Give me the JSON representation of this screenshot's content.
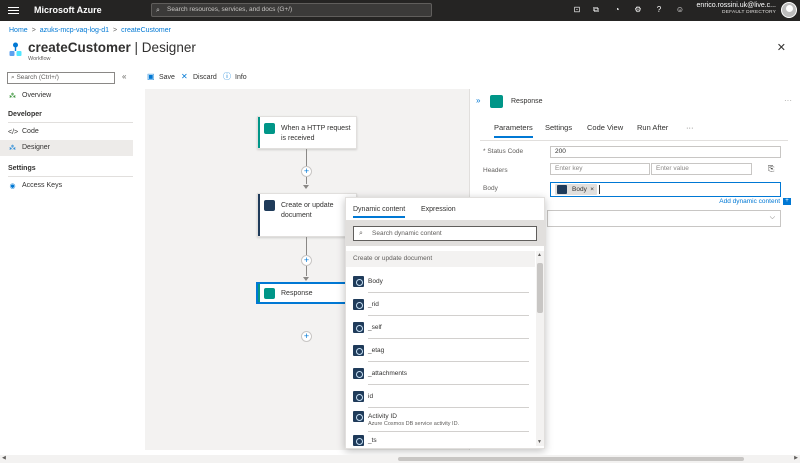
{
  "topbar": {
    "brand": "Microsoft Azure",
    "search_placeholder": "Search resources, services, and docs (G+/)",
    "user_name": "enrico.rossini.uk@live.c...",
    "user_directory": "DEFAULT DIRECTORY"
  },
  "breadcrumb": [
    "Home",
    "azuks-mcp-vaq-log-d1",
    "createCustomer"
  ],
  "header": {
    "title": "createCustomer",
    "title_suffix": " | Designer",
    "subtitle": "Workflow",
    "more": "···",
    "close": "✕"
  },
  "leftnav": {
    "search_placeholder": "Search (Ctrl+/)",
    "collapse": "«",
    "overview": "Overview",
    "developer_heading": "Developer",
    "code": "Code",
    "designer": "Designer",
    "settings_heading": "Settings",
    "access_keys": "Access Keys"
  },
  "toolbar": {
    "save": "Save",
    "discard": "Discard",
    "info": "Info"
  },
  "workflow": {
    "trigger": "When a HTTP request is received",
    "action1": "Create or update document",
    "action2": "Response",
    "add": "+"
  },
  "panel": {
    "title": "Response",
    "more": "···",
    "tabs": [
      "Parameters",
      "Settings",
      "Code View",
      "Run After"
    ],
    "tabs_more": "···",
    "status_code_label": "* Status Code",
    "status_code_value": "200",
    "headers_label": "Headers",
    "headers_key_placeholder": "Enter key",
    "headers_value_placeholder": "Enter value",
    "body_label": "Body",
    "body_token": "Body",
    "add_dynamic": "Add dynamic content"
  },
  "popup": {
    "tabs": [
      "Dynamic content",
      "Expression"
    ],
    "search_placeholder": "Search dynamic content",
    "section": "Create or update document",
    "items": [
      {
        "label": "Body",
        "desc": ""
      },
      {
        "label": "_rid",
        "desc": ""
      },
      {
        "label": "_self",
        "desc": ""
      },
      {
        "label": "_etag",
        "desc": ""
      },
      {
        "label": "_attachments",
        "desc": ""
      },
      {
        "label": "id",
        "desc": ""
      },
      {
        "label": "Activity ID",
        "desc": "Azure Cosmos DB service activity ID."
      },
      {
        "label": "_ts",
        "desc": ""
      }
    ]
  },
  "colors": {
    "topbar": "#252423",
    "accent": "#0078d4",
    "trigger": "#009688",
    "cosmos": "#1f3b5a"
  }
}
